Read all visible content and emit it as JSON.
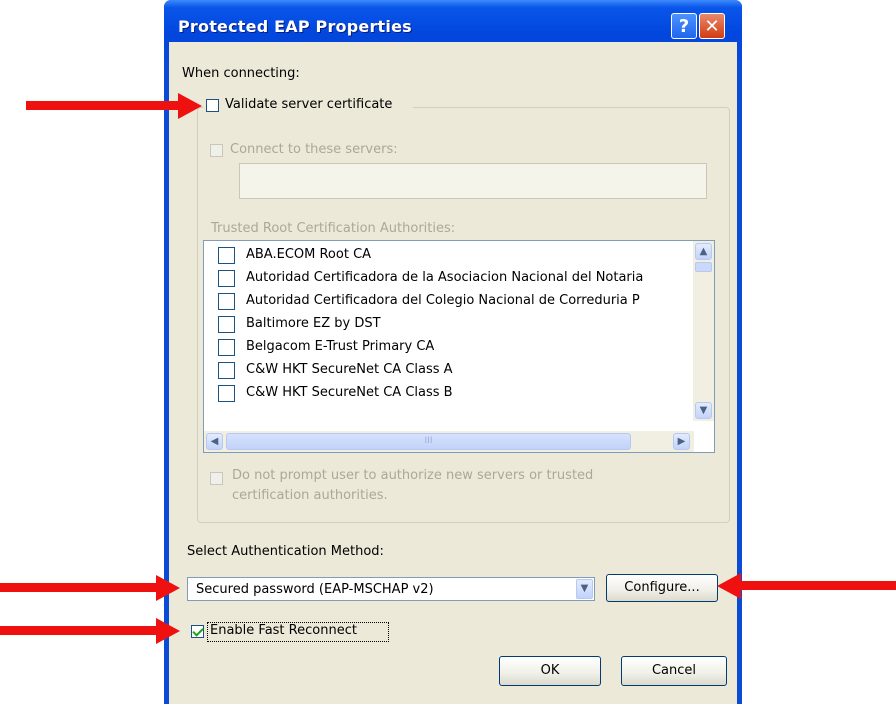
{
  "window": {
    "title": "Protected EAP Properties",
    "help_glyph": "?",
    "close_glyph": "✕"
  },
  "when_connecting_label": "When connecting:",
  "validate_cert": {
    "label": "Validate server certificate",
    "checked": false
  },
  "connect_servers": {
    "label": "Connect to these servers:",
    "value": ""
  },
  "trusted_root_label": "Trusted Root Certification Authorities:",
  "ca_list": [
    "ABA.ECOM Root CA",
    "Autoridad Certificadora de la Asociacion Nacional del Notaria",
    "Autoridad Certificadora del Colegio Nacional de Correduria P",
    "Baltimore EZ by DST",
    "Belgacom E-Trust Primary CA",
    "C&W HKT SecureNet CA Class A",
    "C&W HKT SecureNet CA Class B"
  ],
  "scroll_glyphs": {
    "up": "▲",
    "down": "▼",
    "left": "◀",
    "right": "▶",
    "grip": "III"
  },
  "no_prompt_label_line1": "Do not prompt user to authorize new servers or trusted",
  "no_prompt_label_line2": "certification authorities.",
  "auth_method_label": "Select Authentication Method:",
  "auth_method_value": "Secured password (EAP-MSCHAP v2)",
  "configure_label": "Configure...",
  "fast_reconnect": {
    "label": "Enable Fast Reconnect",
    "checked": true
  },
  "ok_label": "OK",
  "cancel_label": "Cancel",
  "colors": {
    "annotation_arrow": "#ef1010",
    "titlebar": "#0246dd",
    "dialog_bg": "#ece9d8"
  }
}
